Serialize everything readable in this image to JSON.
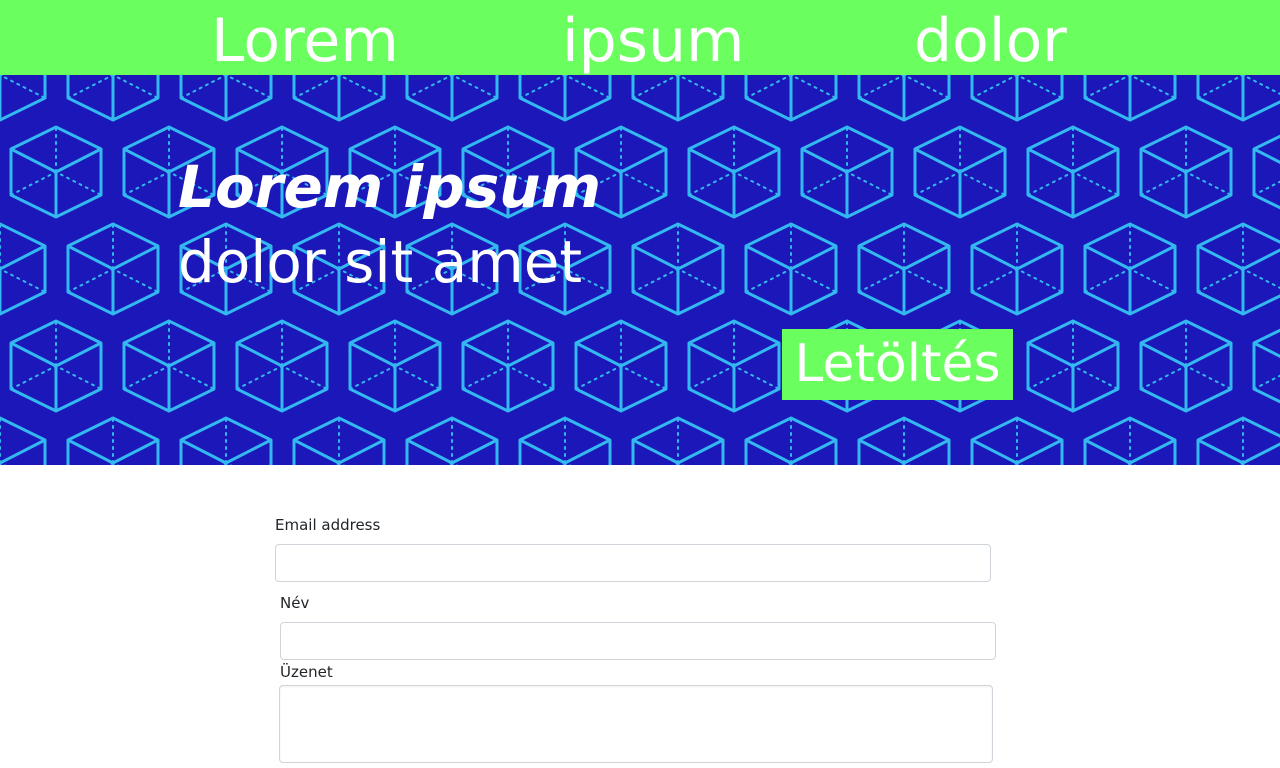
{
  "nav": {
    "items": [
      {
        "label": "Lorem"
      },
      {
        "label": "ipsum"
      },
      {
        "label": "dolor"
      }
    ]
  },
  "hero": {
    "title": "Lorem ipsum",
    "subtitle": "dolor sit amet",
    "download_label": "Letöltés"
  },
  "form": {
    "email_label": "Email address",
    "email_value": "",
    "name_label": "Név",
    "name_value": "",
    "message_label": "Üzenet",
    "message_value": ""
  },
  "colors": {
    "accent_green": "#6aff5e",
    "hero_background": "#1b17b8",
    "pattern_stroke": "#33b8f0"
  }
}
